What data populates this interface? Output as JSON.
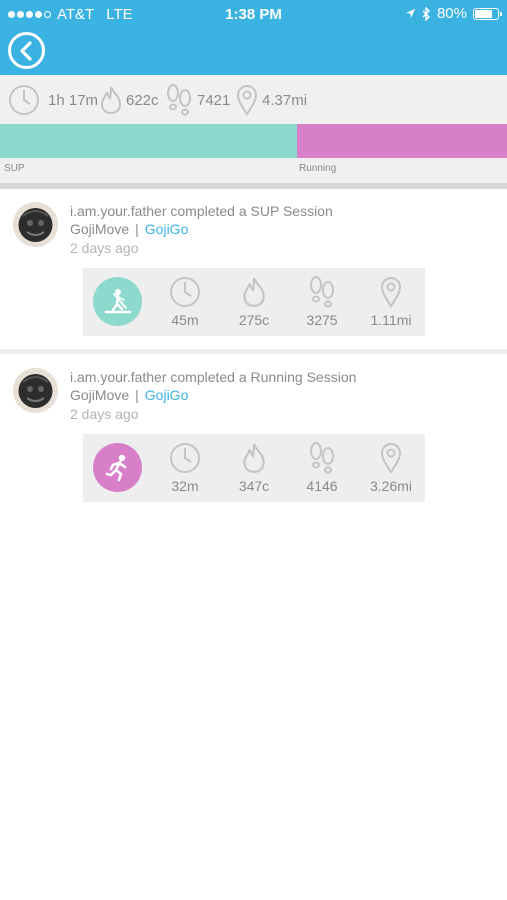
{
  "status_bar": {
    "carrier": "AT&T",
    "network": "LTE",
    "time": "1:38 PM",
    "battery": "80%",
    "battery_level": 0.8
  },
  "summary": {
    "duration": "1h 17m",
    "calories": "622c",
    "steps": "7421",
    "distance": "4.37mi"
  },
  "activity_split": {
    "sup_label": "SUP",
    "running_label": "Running",
    "sup_color": "#8dd9cd",
    "running_color": "#d77fc9",
    "sup_fraction": 0.585
  },
  "feed": [
    {
      "title": "i.am.your.father completed a SUP Session",
      "app": "GojiMove",
      "separator": "|",
      "link": "GojiGo",
      "time_ago": "2 days ago",
      "activity_icon": "paddleboard-icon",
      "badge_color": "#8dd9cd",
      "stats": {
        "duration": "45m",
        "calories": "275c",
        "steps": "3275",
        "distance": "1.11mi"
      }
    },
    {
      "title": "i.am.your.father completed a Running Session",
      "app": "GojiMove",
      "separator": "|",
      "link": "GojiGo",
      "time_ago": "2 days ago",
      "activity_icon": "runner-icon",
      "badge_color": "#d77fc9",
      "stats": {
        "duration": "32m",
        "calories": "347c",
        "steps": "4146",
        "distance": "3.26mi"
      }
    }
  ],
  "colors": {
    "header": "#3ab3e3",
    "link": "#3ab3e3"
  }
}
